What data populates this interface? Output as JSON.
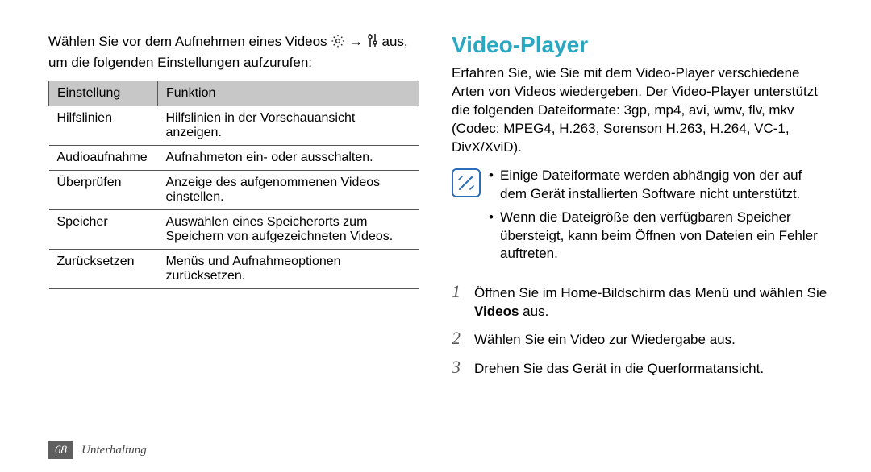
{
  "left": {
    "intro_before": "Wählen Sie vor dem Aufnehmen eines Videos ",
    "intro_arrow": " → ",
    "intro_after": " aus, um die folgenden Einstellungen aufzurufen:",
    "icon_gear_name": "gear-icon",
    "icon_slider_name": "sliders-icon",
    "table": {
      "header_setting": "Einstellung",
      "header_function": "Funktion",
      "rows": [
        {
          "setting": "Hilfslinien",
          "function": "Hilfslinien in der Vorschauansicht anzeigen."
        },
        {
          "setting": "Audioaufnahme",
          "function": "Aufnahmeton ein- oder ausschalten."
        },
        {
          "setting": "Überprüfen",
          "function": "Anzeige des aufgenommenen Videos einstellen."
        },
        {
          "setting": "Speicher",
          "function": "Auswählen eines Speicherorts zum Speichern von aufgezeichneten Videos."
        },
        {
          "setting": "Zurücksetzen",
          "function": "Menüs und Aufnahmeoptionen zurücksetzen."
        }
      ]
    }
  },
  "right": {
    "title": "Video-Player",
    "intro": "Erfahren Sie, wie Sie mit dem Video-Player verschiedene Arten von Videos wiedergeben. Der Video-Player unterstützt die folgenden Dateiformate: 3gp, mp4, avi, wmv, flv, mkv (Codec: MPEG4, H.263, Sorenson H.263, H.264, VC-1, DivX/XviD).",
    "notes": [
      "Einige Dateiformate werden abhängig von der auf dem Gerät installierten Software nicht unterstützt.",
      "Wenn die Dateigröße den verfügbaren Speicher übersteigt, kann beim Öffnen von Dateien ein Fehler auftreten."
    ],
    "steps": [
      {
        "num": "1",
        "prefix": "Öffnen Sie im Home-Bildschirm das Menü und wählen Sie ",
        "bold": "Videos",
        "suffix": " aus."
      },
      {
        "num": "2",
        "prefix": "Wählen Sie ein Video zur Wiedergabe aus.",
        "bold": "",
        "suffix": ""
      },
      {
        "num": "3",
        "prefix": "Drehen Sie das Gerät in die Querformatansicht.",
        "bold": "",
        "suffix": ""
      }
    ]
  },
  "footer": {
    "page": "68",
    "section": "Unterhaltung"
  }
}
